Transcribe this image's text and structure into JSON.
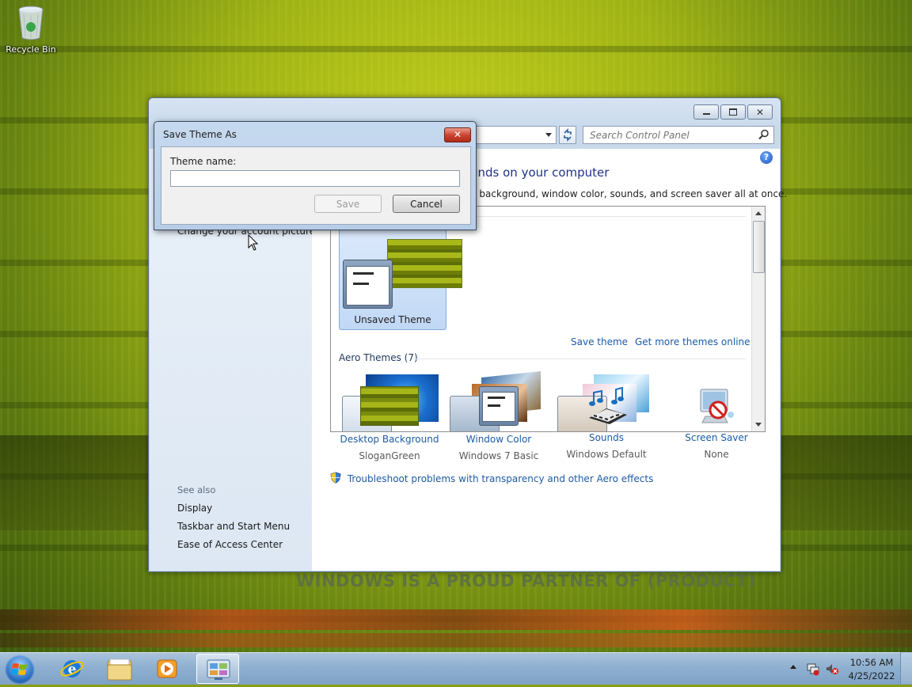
{
  "desktop": {
    "recycle_bin_label": "Recycle Bin",
    "wallpaper_slogan": "WINDOWS IS A PROUD PARTNER OF (PRODUCT)"
  },
  "personalization": {
    "search_placeholder": "Search Control Panel",
    "heading": "unds on your computer",
    "subheading": "p background, window color, sounds, and screen saver all at once.",
    "left_pane": {
      "change_account_picture": "Change your account picture",
      "see_also_label": "See also",
      "see_also_links": [
        "Display",
        "Taskbar and Start Menu",
        "Ease of Access Center"
      ]
    },
    "my_themes": {
      "unsaved_theme_label": "Unsaved Theme",
      "save_theme_link": "Save theme",
      "get_more_link": "Get more themes online"
    },
    "aero_themes_label": "Aero Themes (7)",
    "bottom_items": [
      {
        "title": "Desktop Background",
        "value": "SloganGreen",
        "icon": "wallpaper-thumbnail-icon"
      },
      {
        "title": "Window Color",
        "value": "Windows 7 Basic",
        "icon": "window-color-icon"
      },
      {
        "title": "Sounds",
        "value": "Windows Default",
        "icon": "sounds-icon"
      },
      {
        "title": "Screen Saver",
        "value": "None",
        "icon": "screen-saver-icon"
      }
    ],
    "troubleshoot_link": "Troubleshoot problems with transparency and other Aero effects"
  },
  "save_dialog": {
    "title": "Save Theme As",
    "theme_name_label": "Theme name:",
    "theme_name_value": "",
    "save_button": "Save",
    "cancel_button": "Cancel"
  },
  "taskbar": {
    "time": "10:56 AM",
    "date": "4/25/2022",
    "pinned": [
      "internet-explorer-icon",
      "windows-explorer-icon",
      "media-player-icon",
      "control-panel-icon"
    ]
  },
  "colors": {
    "link": "#1c5ba6",
    "heading": "#1e3287",
    "selection": "#c1d8f5"
  }
}
